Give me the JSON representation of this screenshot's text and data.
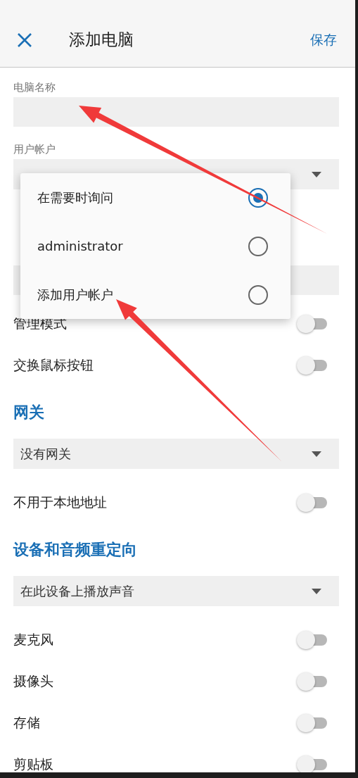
{
  "app_bar": {
    "title": "添加电脑",
    "action": "保存"
  },
  "form": [
    {
      "kind": "field_label",
      "text": "电脑名称"
    },
    {
      "kind": "text_field"
    },
    {
      "kind": "field_label",
      "text": "用户帐户"
    },
    {
      "kind": "dropdown"
    },
    {
      "kind": "covered_field"
    },
    {
      "kind": "switch",
      "label": "管理模式",
      "on": false
    },
    {
      "kind": "switch",
      "label": "交换鼠标按钮",
      "on": false
    },
    {
      "kind": "heading",
      "text": "网关"
    },
    {
      "kind": "dropdown",
      "value": "没有网关"
    },
    {
      "kind": "switch",
      "label": "不用于本地地址",
      "on": false
    },
    {
      "kind": "heading",
      "text": "设备和音频重定向"
    },
    {
      "kind": "dropdown",
      "value": "在此设备上播放声音"
    },
    {
      "kind": "switch",
      "label": "麦克风",
      "on": false
    },
    {
      "kind": "switch",
      "label": "摄像头",
      "on": false
    },
    {
      "kind": "switch",
      "label": "存储",
      "on": false
    },
    {
      "kind": "switch",
      "label": "剪贴板",
      "on": false
    }
  ],
  "account_menu": {
    "options": [
      {
        "label": "在需要时询问",
        "selected": true
      },
      {
        "label": "administrator",
        "selected": false
      },
      {
        "label": "添加用户帐户",
        "selected": false
      }
    ]
  }
}
